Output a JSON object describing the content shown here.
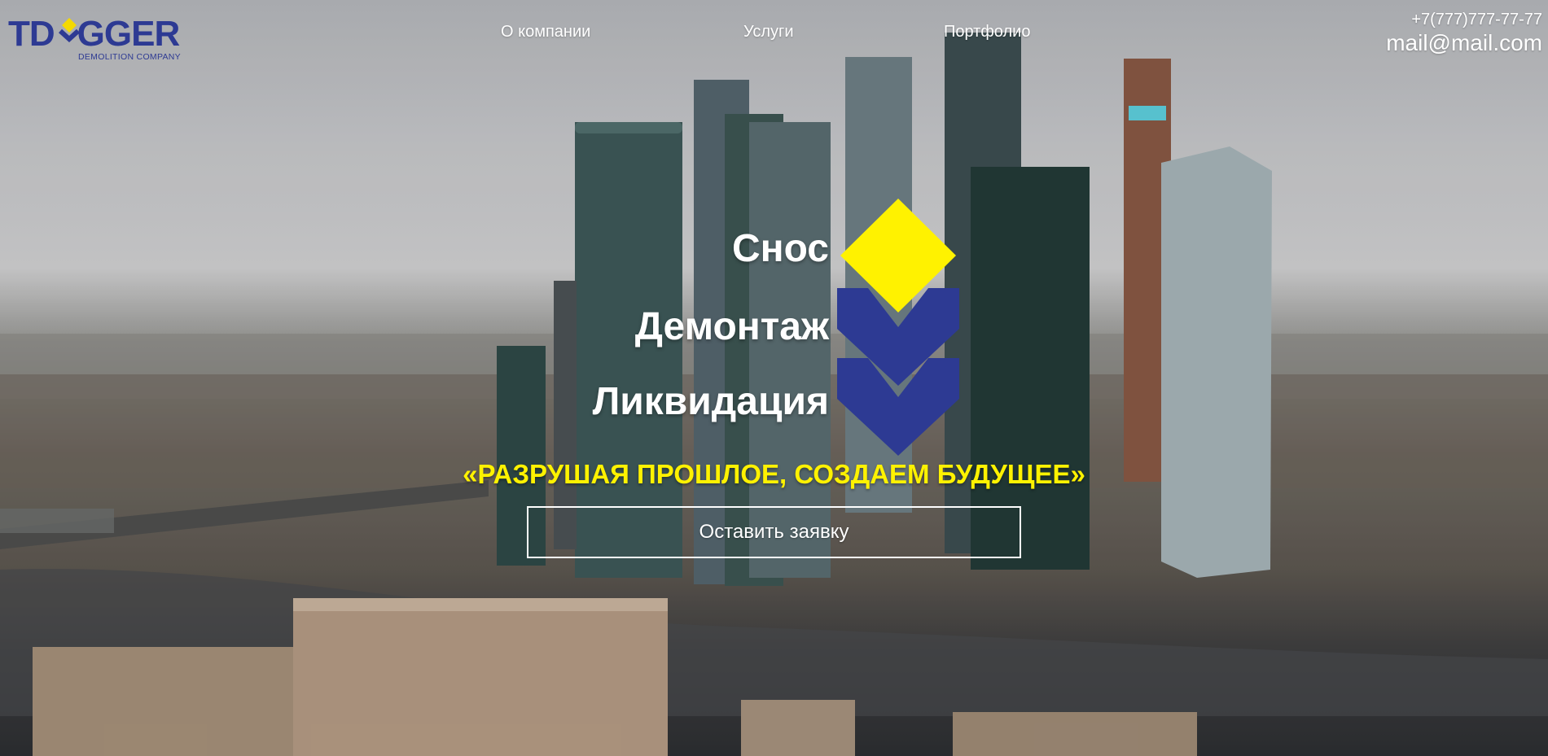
{
  "brand": {
    "logo_left": "TD",
    "logo_right": "GGER",
    "tagline": "DEMOLITION COMPANY",
    "color": "#2d3a93"
  },
  "nav": {
    "items": [
      {
        "label": "О компании"
      },
      {
        "label": "Услуги"
      },
      {
        "label": "Портфолио"
      }
    ]
  },
  "contacts": {
    "phone": "+7(777)777-77-77",
    "email": "mail@mail.com"
  },
  "hero": {
    "words": [
      "Снос",
      "Демонтаж",
      "Ликвидация"
    ],
    "slogan": "«РАЗРУШАЯ ПРОШЛОЕ, СОЗДАЕМ БУДУЩЕЕ»",
    "cta_label": "Оставить заявку"
  },
  "colors": {
    "accent_yellow": "#fff200",
    "brand_blue": "#2d3a93",
    "text": "#ffffff"
  },
  "icons": {
    "emblem": "diamond-chevrons-emblem",
    "background": "moscow-city-skyline-photo"
  }
}
